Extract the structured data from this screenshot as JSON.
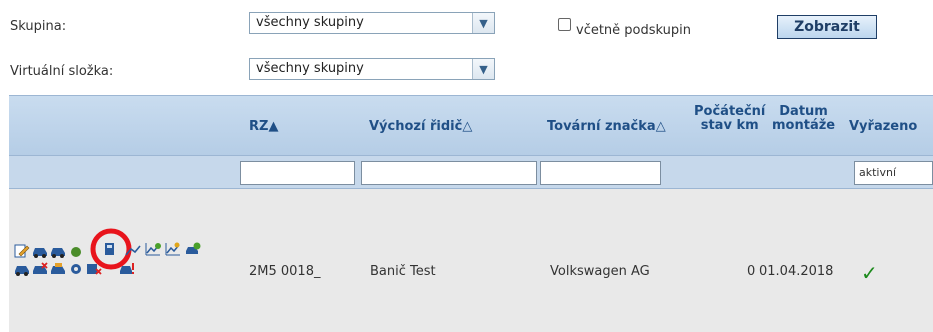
{
  "filters": {
    "group_label": "Skupina:",
    "group_value": "všechny skupiny",
    "include_subgroups_label": "včetně podskupin",
    "show_button": "Zobrazit",
    "virtual_folder_label": "Virtuální složka:",
    "virtual_folder_value": "všechny skupiny"
  },
  "table": {
    "columns": [
      {
        "label": "RZ",
        "sort": "▲"
      },
      {
        "label": "Výchozí řidič",
        "sort": "△"
      },
      {
        "label": "Tovární značka",
        "sort": "△"
      },
      {
        "label": "Počáteční stav km"
      },
      {
        "label": "Datum montáže"
      },
      {
        "label": "Vyřazeno"
      }
    ],
    "col_pocatecni_1": "Počáteční",
    "col_pocatecni_2": "stav km",
    "col_datum_1": "Datum",
    "col_datum_2": "montáže",
    "status_filter_value": "aktivní",
    "rows": [
      {
        "rz": "2M5 0018_",
        "driver": "Banič Test",
        "brand": "Volkswagen AG",
        "km": "0",
        "date": "01.04.2018",
        "retired_mark": "✓"
      }
    ]
  },
  "colors": {
    "header_text": "#1f4f86",
    "header_bg": "#c9dcef",
    "highlight_circle": "#e8141c",
    "check_green": "#1c8a1c"
  },
  "row_icons": [
    "edit-icon",
    "car-icon",
    "car-icon",
    "car-add-icon",
    "fuel-icon",
    "graph-icon",
    "graph-icon",
    "graph-icon",
    "car-info-icon",
    "car-icon",
    "car-delete-icon",
    "car-icon",
    "gear-icon",
    "car-delete-icon",
    "car-alert-icon"
  ]
}
